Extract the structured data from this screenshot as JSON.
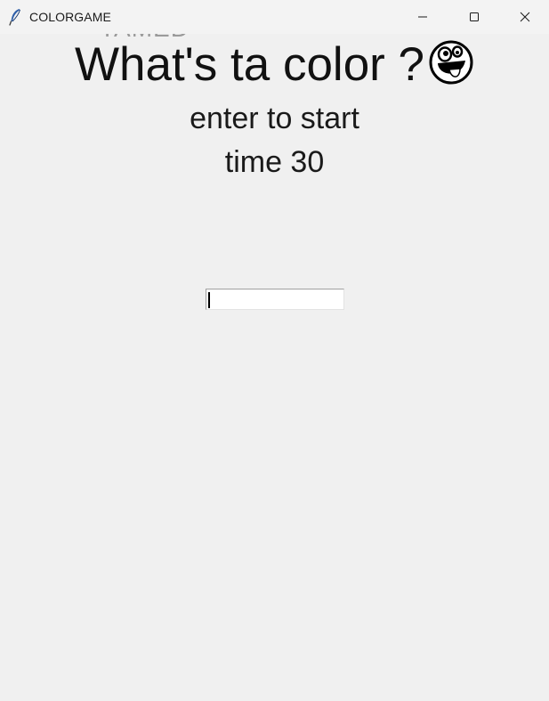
{
  "window": {
    "title": "COLORGAME",
    "app_icon": "feather-icon",
    "controls": {
      "minimize": "minimize-icon",
      "maximize": "maximize-icon",
      "close": "close-icon"
    }
  },
  "game": {
    "ghost_text": "TAMED",
    "headline": "What's ta color ?",
    "headline_emoji": "crazy-face-icon",
    "instruction": "enter to start",
    "timer": "time 30",
    "entry_value": ""
  },
  "colors": {
    "background": "#f0f0f0",
    "titlebar": "#f3f3f3",
    "text": "#1a1a1a",
    "ghost": "#9a9a9a",
    "entry_bg": "#ffffff"
  }
}
